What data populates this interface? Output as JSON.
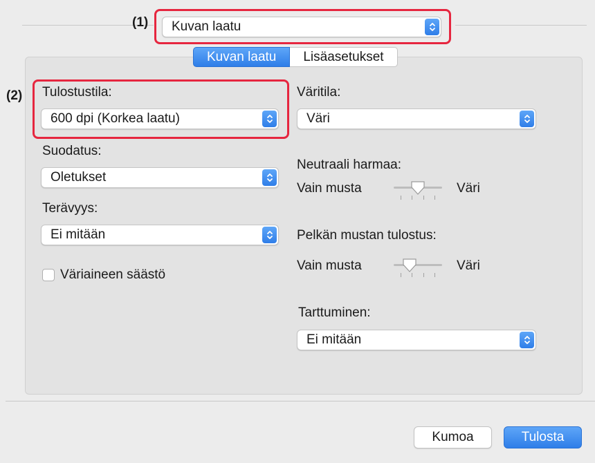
{
  "annotations": {
    "marker_1": "(1)",
    "marker_2": "(2)",
    "highlight_color": "#e6263f"
  },
  "panel_menu": {
    "selected": "Kuvan laatu",
    "icon": "chevron-updown-icon"
  },
  "tabs": [
    {
      "label": "Kuvan laatu",
      "active": true
    },
    {
      "label": "Lisäasetukset",
      "active": false
    }
  ],
  "left": {
    "print_mode": {
      "label": "Tulostustila:",
      "value": "600 dpi (Korkea laatu)"
    },
    "filter": {
      "label": "Suodatus:",
      "value": "Oletukset"
    },
    "sharpness": {
      "label": "Terävyys:",
      "value": "Ei mitään"
    },
    "toner_save": {
      "label": "Väriaineen säästö",
      "checked": false
    }
  },
  "right": {
    "color_mode": {
      "label": "Väritila:",
      "value": "Väri"
    },
    "neutral_gray": {
      "label": "Neutraali harmaa:",
      "min_label": "Vain musta",
      "max_label": "Väri",
      "level": 0.5
    },
    "pure_black": {
      "label": "Pelkän mustan tulostus:",
      "min_label": "Vain musta",
      "max_label": "Väri",
      "level": 0.33
    },
    "trapping": {
      "label": "Tarttuminen:",
      "value": "Ei mitään"
    }
  },
  "buttons": {
    "cancel": "Kumoa",
    "print": "Tulosta"
  },
  "colors": {
    "accent": "#2f7ee8",
    "panel_bg": "#e3e3e3",
    "dialog_bg": "#ececec"
  }
}
